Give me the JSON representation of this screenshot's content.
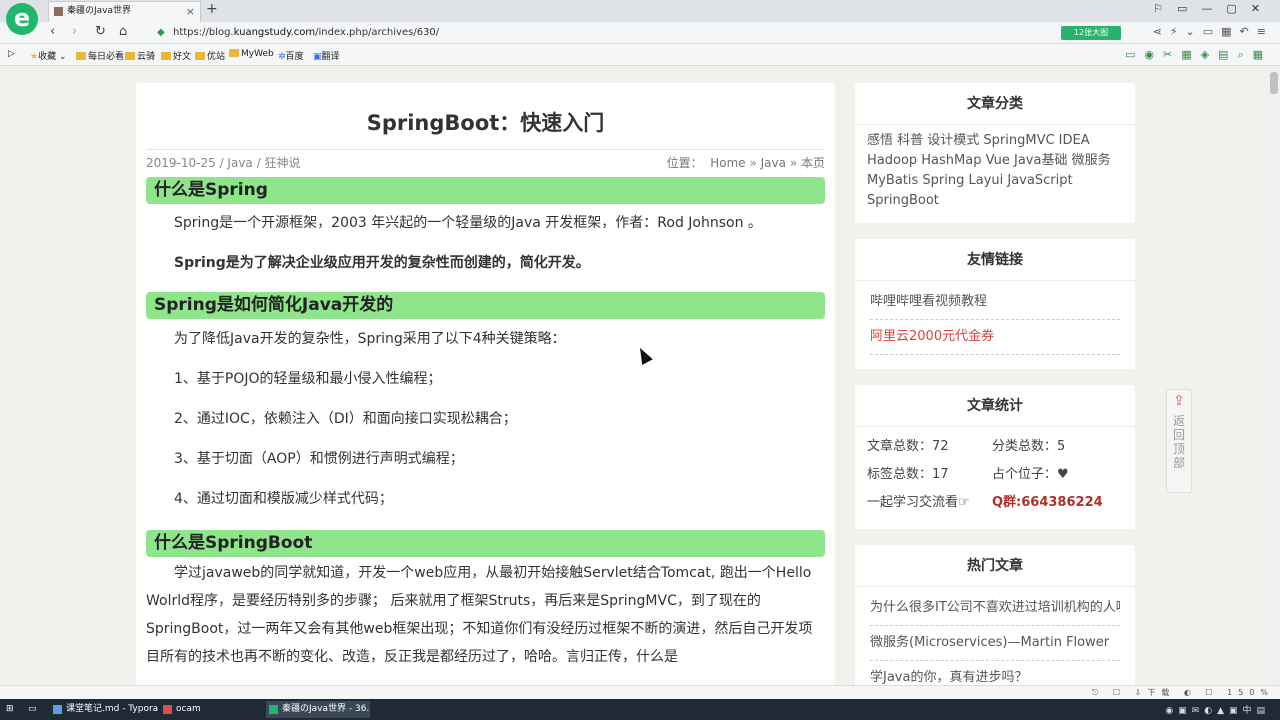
{
  "browser": {
    "logo": "e",
    "tab_title": "秦疆のJava世界",
    "tab_close": "×",
    "new_tab": "+",
    "url_prefix": "https://blog.",
    "url_domain": "kuangstudy.com",
    "url_path": "/index.php/archives/630/",
    "big_pic_label": "12张大图"
  },
  "bookmarks": {
    "items": [
      "收藏",
      "每日必看",
      "云骑",
      "好文",
      "优站",
      "MyWeb",
      "百度",
      "翻译"
    ]
  },
  "article": {
    "title": "SpringBoot：快速入门",
    "date": "2019-10-25",
    "category": "Java",
    "author": "狂神说",
    "location_label": "位置：",
    "crumb_home": "Home",
    "crumb_cat": "Java",
    "crumb_current": "本页",
    "h_spring": "什么是Spring",
    "p1": "Spring是一个开源框架，2003 年兴起的一个轻量级的Java 开发框架，作者：Rod Johnson 。",
    "p2": "Spring是为了解决企业级应用开发的复杂性而创建的，简化开发。",
    "h_simplify": "Spring是如何简化Java开发的",
    "p3": "为了降低Java开发的复杂性，Spring采用了以下4种关键策略：",
    "s1": "1、基于POJO的轻量级和最小侵入性编程；",
    "s2": "2、通过IOC，依赖注入（DI）和面向接口实现松耦合；",
    "s3": "3、基于切面（AOP）和惯例进行声明式编程；",
    "s4": "4、通过切面和模版减少样式代码；",
    "h_boot": "什么是SpringBoot",
    "p4": "学过javaweb的同学就知道，开发一个web应用，从最初开始接触Servlet结合Tomcat, 跑出一个Hello Wolrld程序，是要经历特别多的步骤； 后来就用了框架Struts，再后来是SpringMVC，到了现在的SpringBoot，过一两年又会有其他web框架出现；不知道你们有没经历过框架不断的演进，然后自己开发项目所有的技术也再不断的变化、改造，反正我是都经历过了，哈哈。言归正传，什么是"
  },
  "sidebar": {
    "categories_title": "文章分类",
    "categories_text": "感悟 科普 设计模式 SpringMVC IDEA Hadoop HashMap Vue Java基础 微服务 MyBatis Spring Layui JavaScript SpringBoot",
    "links_title": "友情链接",
    "link1": "哔哩哔哩看视频教程",
    "link2": "阿里云2000元代金券",
    "stats_title": "文章统计",
    "stat_articles": "文章总数：72",
    "stat_categories": "分类总数：5",
    "stat_tags": "标签总数：17",
    "stat_spot": "占个位子：",
    "stat_join": "一起学习交流看☞",
    "stat_qq": "Q群:664386224",
    "hot_title": "热门文章",
    "hot1": "为什么很多IT公司不喜欢进过培训机构的人呢",
    "hot2": "微服务(Microservices)—Martin Flower",
    "hot3": "学Java的你，真有进步吗？"
  },
  "backtop": {
    "label": "返回顶部"
  },
  "statusbar": {
    "zoom": "150%",
    "download": "下载"
  },
  "taskbar": {
    "item1": "课堂笔记.md - Typora",
    "item2": "ocam",
    "item3": "秦疆のJava世界 - 36..."
  },
  "colors": {
    "heading_bg": "#8ee58a",
    "qq": "#b0302a",
    "link_red": "#d9443a",
    "brand_green": "#1fb86a"
  }
}
